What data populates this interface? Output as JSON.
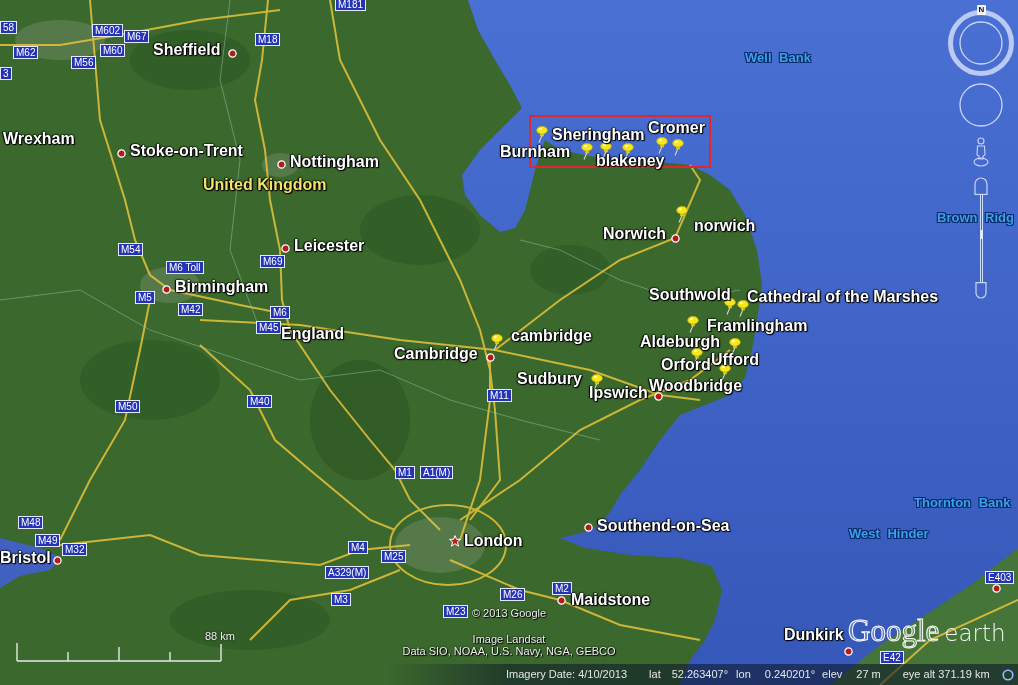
{
  "map": {
    "places": [
      {
        "name": "Sheffield",
        "kind": "city"
      },
      {
        "name": "Wrexham",
        "kind": "region"
      },
      {
        "name": "Stoke-on-Trent",
        "kind": "city"
      },
      {
        "name": "Nottingham",
        "kind": "city"
      },
      {
        "name": "United Kingdom",
        "kind": "country"
      },
      {
        "name": "Norwich",
        "kind": "city"
      },
      {
        "name": "Leicester",
        "kind": "city"
      },
      {
        "name": "Birmingham",
        "kind": "city"
      },
      {
        "name": "England",
        "kind": "region"
      },
      {
        "name": "Cambridge",
        "kind": "city"
      },
      {
        "name": "Southend-on-Sea",
        "kind": "city"
      },
      {
        "name": "London",
        "kind": "capital"
      },
      {
        "name": "Bristol",
        "kind": "city"
      },
      {
        "name": "Maidstone",
        "kind": "city"
      },
      {
        "name": "Dunkirk",
        "kind": "city"
      }
    ],
    "placemarks": [
      "Cromer",
      "Sheringham",
      "Burnham",
      "blakeney",
      "norwich",
      "Southwold",
      "Cathedral of the Marshes",
      "Framlingham",
      "cambridge",
      "Aldeburgh",
      "Ufford",
      "Orford",
      "Sudbury",
      "Woodbridge",
      "Ipswich"
    ],
    "road_signs": [
      "M181",
      "58",
      "M602",
      "M67",
      "M18",
      "M60",
      "M62",
      "M56",
      "3",
      "M54",
      "M69",
      "M6 Toll",
      "M5",
      "M42",
      "M6",
      "M45",
      "M11",
      "M40",
      "M50",
      "M1",
      "A1(M)",
      "M48",
      "M49",
      "M4",
      "M32",
      "M25",
      "A329(M)",
      "E403",
      "M2",
      "M26",
      "M3",
      "M23",
      "E42"
    ],
    "sea_features": [
      "Well Bank",
      "Brown Ridg",
      "Thornton Bank",
      "West Hinder"
    ],
    "scale": {
      "label": "88 km"
    },
    "attribution": [
      "© 2013 Google",
      "Image Landsat",
      "Data SIO, NOAA, U.S. Navy, NGA, GEBCO"
    ],
    "logo": {
      "brand": "Google",
      "product": "earth"
    }
  },
  "navigation": {
    "north": "N",
    "zoom_slider": {
      "level": 0.55
    }
  },
  "status_bar": {
    "imagery_date": "Imagery Date: 4/10/2013",
    "readings": [
      {
        "label": "lat",
        "value": "52.263407°"
      },
      {
        "label": "lon",
        "value": "0.240201°"
      },
      {
        "label": "elev",
        "value": "27 m"
      }
    ],
    "eye_alt": "eye alt 371.19 km"
  }
}
